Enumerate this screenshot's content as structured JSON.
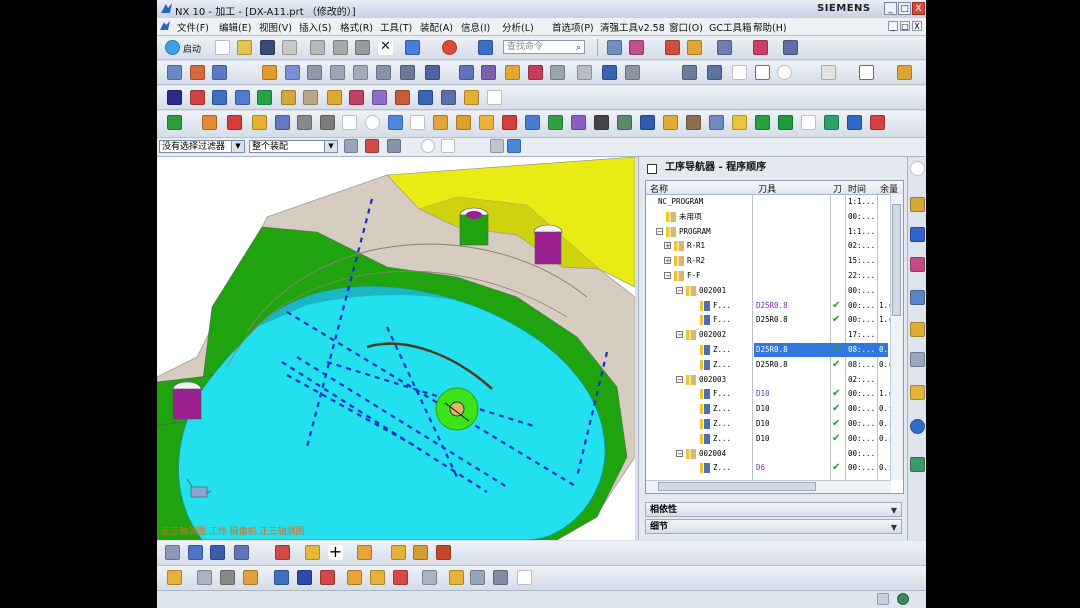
{
  "window": {
    "title": "NX 10 - 加工 - [DX-A11.prt （修改的）]",
    "brand": "SIEMENS",
    "controls": [
      "_",
      "□",
      "X"
    ]
  },
  "menu": {
    "items": [
      "文件(F)",
      "编辑(E)",
      "视图(V)",
      "插入(S)",
      "格式(R)",
      "工具(T)",
      "装配(A)",
      "信息(I)",
      "分析(L)",
      "首选项(P)",
      "清强工具v2.58",
      "窗口(O)",
      "GC工具箱",
      "帮助(H)"
    ],
    "mdi_controls": [
      "_",
      "□",
      "X"
    ]
  },
  "toolbar1": {
    "start_label": "启动",
    "search_placeholder": "查找命令"
  },
  "filterbar": {
    "selection_filter": "没有选择过滤器",
    "scope": "整个装配"
  },
  "viewport": {
    "status_text": "正三轴测图 工作 摄像机 正三轴测图"
  },
  "navigator": {
    "title": "工序导航器 - 程序顺序",
    "columns": [
      "名称",
      "刀具",
      "刀",
      "时间",
      "余量"
    ],
    "rows": [
      {
        "name": "NC_PROGRAM",
        "tool": "",
        "check": false,
        "time": "1:1...",
        "rem": "",
        "level": 0,
        "expander": "",
        "icon": "none"
      },
      {
        "name": "未用项",
        "tool": "",
        "check": false,
        "time": "00:...",
        "rem": "",
        "level": 1,
        "expander": "",
        "icon": "folder"
      },
      {
        "name": "PROGRAM",
        "tool": "",
        "check": false,
        "time": "1:1...",
        "rem": "",
        "level": 1,
        "expander": "−",
        "icon": "folder"
      },
      {
        "name": "R-R1",
        "tool": "",
        "check": false,
        "time": "02:...",
        "rem": "",
        "level": 2,
        "expander": "+",
        "icon": "folder"
      },
      {
        "name": "R-R2",
        "tool": "",
        "check": false,
        "time": "15:...",
        "rem": "",
        "level": 2,
        "expander": "+",
        "icon": "folder"
      },
      {
        "name": "F-F",
        "tool": "",
        "check": false,
        "time": "22:...",
        "rem": "",
        "level": 2,
        "expander": "−",
        "icon": "folder"
      },
      {
        "name": "002001",
        "tool": "",
        "check": false,
        "time": "00:...",
        "rem": "",
        "level": 3,
        "expander": "−",
        "icon": "folder"
      },
      {
        "name": "F...",
        "tool": "D25R0.8",
        "check": true,
        "time": "00:...",
        "rem": "1.(",
        "level": 4,
        "expander": "",
        "icon": "op",
        "purple": true
      },
      {
        "name": "F...",
        "tool": "D25R0.8",
        "check": true,
        "time": "00:...",
        "rem": "1.(",
        "level": 4,
        "expander": "",
        "icon": "op"
      },
      {
        "name": "002002",
        "tool": "",
        "check": false,
        "time": "17:...",
        "rem": "",
        "level": 3,
        "expander": "−",
        "icon": "folder"
      },
      {
        "name": "Z...",
        "tool": "D25R0.8",
        "check": true,
        "time": "08:...",
        "rem": "0.(",
        "level": 4,
        "expander": "",
        "icon": "op",
        "selected": true
      },
      {
        "name": "Z...",
        "tool": "D25R0.8",
        "check": true,
        "time": "08:...",
        "rem": "0.(",
        "level": 4,
        "expander": "",
        "icon": "op"
      },
      {
        "name": "002003",
        "tool": "",
        "check": false,
        "time": "02:...",
        "rem": "",
        "level": 3,
        "expander": "−",
        "icon": "folder"
      },
      {
        "name": "F...",
        "tool": "D10",
        "check": true,
        "time": "00:...",
        "rem": "1.(",
        "level": 4,
        "expander": "",
        "icon": "op",
        "purple": true
      },
      {
        "name": "Z...",
        "tool": "D10",
        "check": true,
        "time": "00:...",
        "rem": "0.:",
        "level": 4,
        "expander": "",
        "icon": "op"
      },
      {
        "name": "Z...",
        "tool": "D10",
        "check": true,
        "time": "00:...",
        "rem": "0.:",
        "level": 4,
        "expander": "",
        "icon": "op"
      },
      {
        "name": "Z...",
        "tool": "D10",
        "check": true,
        "time": "00:...",
        "rem": "0.:",
        "level": 4,
        "expander": "",
        "icon": "op"
      },
      {
        "name": "002004",
        "tool": "",
        "check": false,
        "time": "00:...",
        "rem": "",
        "level": 3,
        "expander": "−",
        "icon": "folder"
      },
      {
        "name": "Z...",
        "tool": "D6",
        "check": true,
        "time": "00:...",
        "rem": "0.:",
        "level": 4,
        "expander": "",
        "icon": "op",
        "purple": true
      }
    ],
    "panels": [
      "相依性",
      "细节"
    ]
  },
  "colors": {
    "selection": "#3276e0",
    "check": "#1aa51a",
    "status_text": "#e06a1b",
    "part_cyan": "#22e0ee",
    "part_green": "#1fa40f",
    "part_yellow": "#e8ec14"
  }
}
